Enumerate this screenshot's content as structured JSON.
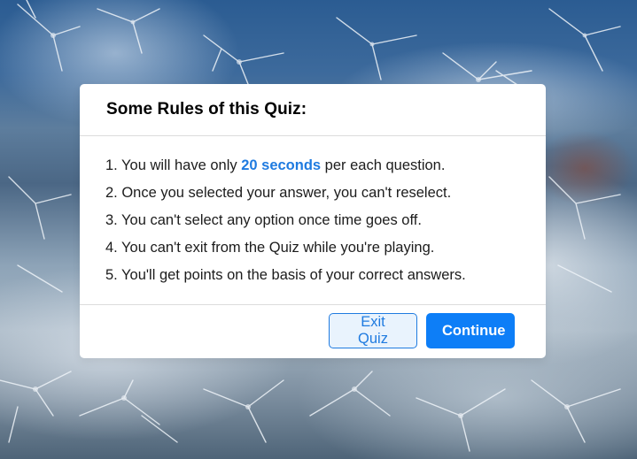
{
  "dialog": {
    "title": "Some Rules of this Quiz:",
    "rules": [
      {
        "prefix": "1. You will have only ",
        "highlight": "20 seconds",
        "suffix": " per each question."
      },
      {
        "text": "2. Once you selected your answer, you can't reselect."
      },
      {
        "text": "3. You can't select any option once time goes off."
      },
      {
        "text": "4. You can't exit from the Quiz while you're playing."
      },
      {
        "text": "5. You'll get points on the basis of your correct answers."
      }
    ],
    "exit_label": "Exit Quiz",
    "continue_label": "Continue"
  },
  "colors": {
    "accent": "#0d7ef7",
    "highlight_text": "#1f7be0"
  }
}
